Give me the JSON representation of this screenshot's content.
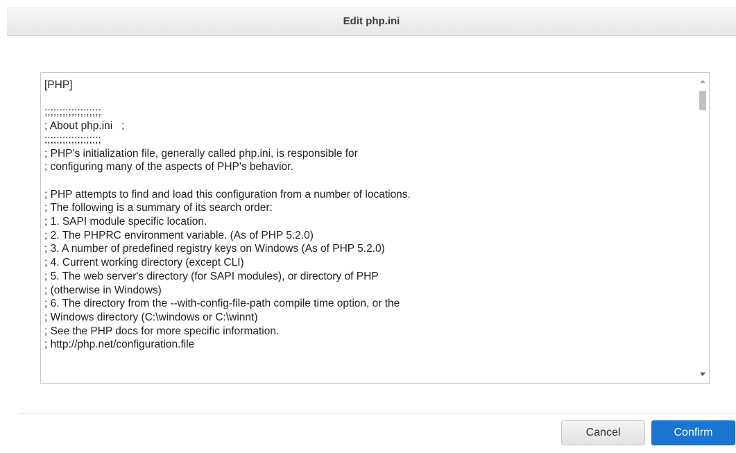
{
  "dialog": {
    "title": "Edit php.ini"
  },
  "editor": {
    "lines": [
      "[PHP]",
      "",
      ";;;;;;;;;;;;;;;;;;;",
      "; About php.ini   ;",
      ";;;;;;;;;;;;;;;;;;;",
      "; PHP's initialization file, generally called php.ini, is responsible for",
      "; configuring many of the aspects of PHP's behavior.",
      "",
      "; PHP attempts to find and load this configuration from a number of locations.",
      "; The following is a summary of its search order:",
      "; 1. SAPI module specific location.",
      "; 2. The PHPRC environment variable. (As of PHP 5.2.0)",
      "; 3. A number of predefined registry keys on Windows (As of PHP 5.2.0)",
      "; 4. Current working directory (except CLI)",
      "; 5. The web server's directory (for SAPI modules), or directory of PHP",
      "; (otherwise in Windows)",
      "; 6. The directory from the --with-config-file-path compile time option, or the",
      "; Windows directory (C:\\windows or C:\\winnt)",
      "; See the PHP docs for more specific information.",
      "; http://php.net/configuration.file"
    ]
  },
  "buttons": {
    "cancel": "Cancel",
    "confirm": "Confirm"
  },
  "colors": {
    "accent": "#1a76d2"
  }
}
